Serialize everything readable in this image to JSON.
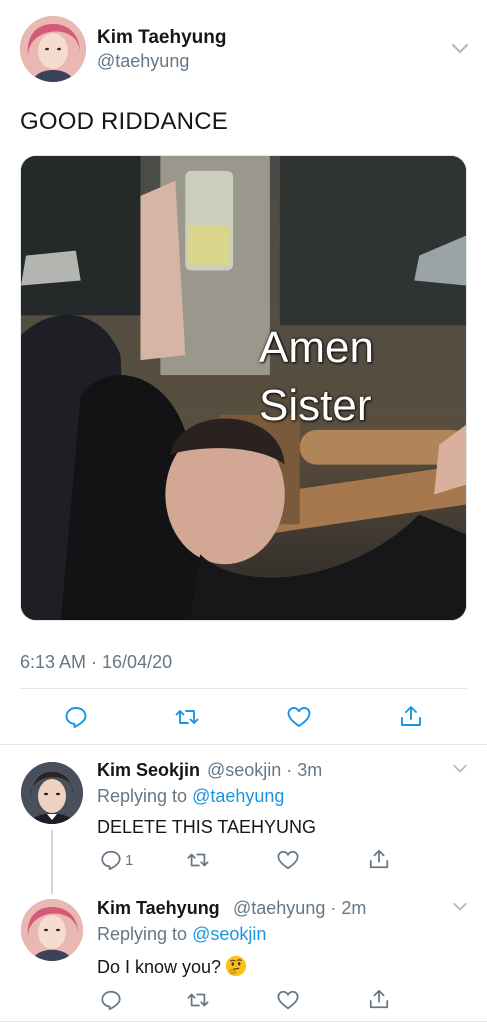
{
  "main_tweet": {
    "author_name": "Kim Taehyung",
    "author_handle": "@taehyung",
    "text": "GOOD RIDDANCE",
    "media_caption_line1": "Amen",
    "media_caption_line2": "Sister",
    "timestamp": "6:13 AM · 16/04/20",
    "actions": [
      "reply-icon",
      "retweet-icon",
      "like-icon",
      "share-icon"
    ]
  },
  "replies": [
    {
      "author_name": "Kim Seokjin",
      "author_handle_time": "@seokjin · 3m",
      "replying_prefix": "Replying to ",
      "replying_to": "@taehyung",
      "text": "DELETE THIS TAEHYUNG",
      "reply_count": "1"
    },
    {
      "author_name": "Kim Taehyung",
      "author_handle_time": "@taehyung · 2m",
      "replying_prefix": "Replying to ",
      "replying_to": "@seokjin",
      "text": "Do I know you?",
      "emoji": "thinking-face-emoji",
      "reply_count": ""
    }
  ],
  "colors": {
    "text_primary": "#14171a",
    "text_secondary": "#657786",
    "link": "#1b95e0",
    "divider": "#e1e8ed",
    "icon": "#657786",
    "main_icon": "#1b95e0"
  }
}
